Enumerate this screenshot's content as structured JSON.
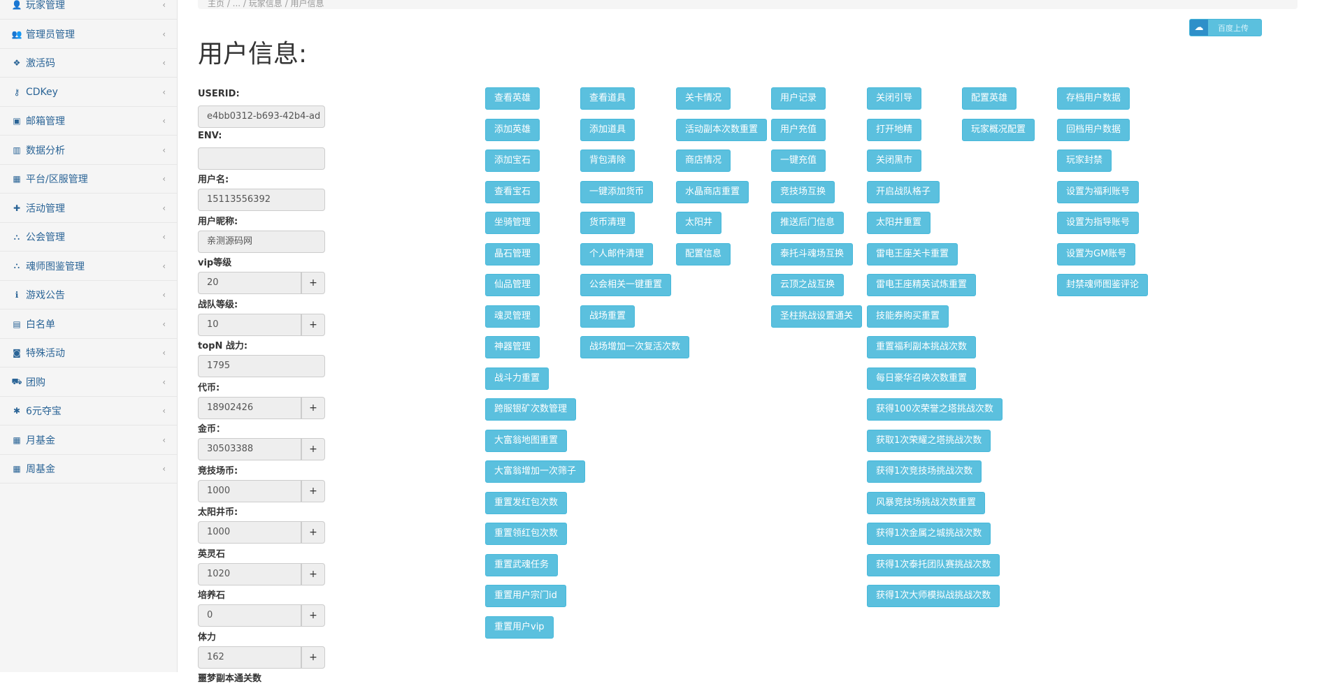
{
  "sidebar": {
    "items": [
      {
        "label": "玩家管理",
        "icon": "user-icon",
        "glyph": "👤"
      },
      {
        "label": "管理员管理",
        "icon": "users-icon",
        "glyph": "👥"
      },
      {
        "label": "激活码",
        "icon": "cube-icon",
        "glyph": "❖"
      },
      {
        "label": "CDKey",
        "icon": "key-icon",
        "glyph": "⚷"
      },
      {
        "label": "邮箱管理",
        "icon": "inbox-icon",
        "glyph": "▣"
      },
      {
        "label": "数据分析",
        "icon": "bar-chart-icon",
        "glyph": "▥"
      },
      {
        "label": "平台/区服管理",
        "icon": "bank-icon",
        "glyph": "▦"
      },
      {
        "label": "活动管理",
        "icon": "gift-icon",
        "glyph": "✚"
      },
      {
        "label": "公会管理",
        "icon": "sitemap-icon",
        "glyph": "⛬"
      },
      {
        "label": "魂师图鉴管理",
        "icon": "sitemap-icon",
        "glyph": "⛬"
      },
      {
        "label": "游戏公告",
        "icon": "info-icon",
        "glyph": "ℹ"
      },
      {
        "label": "白名单",
        "icon": "file-icon",
        "glyph": "▤"
      },
      {
        "label": "特殊活动",
        "icon": "money-icon",
        "glyph": "◙"
      },
      {
        "label": "团购",
        "icon": "cart-icon",
        "glyph": "⛟"
      },
      {
        "label": "6元夺宝",
        "icon": "asterisk-icon",
        "glyph": "✱"
      },
      {
        "label": "月基金",
        "icon": "calendar-icon",
        "glyph": "▦"
      },
      {
        "label": "周基金",
        "icon": "calendar-icon",
        "glyph": "▦"
      }
    ],
    "chevron": "‹"
  },
  "breadcrumb": "主页 / ... / 玩家信息 / 用户信息",
  "page_title": "用户信息:",
  "cloud_button": {
    "label": "百度上传",
    "glyph": "☁"
  },
  "form": {
    "fields": [
      {
        "label": "USERID:",
        "value": "e4bb0312-b693-42b4-ad",
        "plus": false
      },
      {
        "label": "ENV:",
        "value": "",
        "plus": false
      },
      {
        "label": "用户名:",
        "value": "15113556392",
        "plus": false
      },
      {
        "label": "用户昵称:",
        "value": "亲测源码网",
        "plus": false
      },
      {
        "label": "vip等级",
        "value": "20",
        "plus": true
      },
      {
        "label": "战队等级:",
        "value": "10",
        "plus": true
      },
      {
        "label": "topN 战力:",
        "value": "1795",
        "plus": false
      },
      {
        "label": "代币:",
        "value": "18902426",
        "plus": true
      },
      {
        "label": "金币：",
        "value": "30503388",
        "plus": true
      },
      {
        "label": "竞技场币:",
        "value": "1000",
        "plus": true
      },
      {
        "label": "太阳井币:",
        "value": "1000",
        "plus": true
      },
      {
        "label": "英灵石",
        "value": "1020",
        "plus": true
      },
      {
        "label": "培养石",
        "value": "0",
        "plus": true
      },
      {
        "label": "体力",
        "value": "162",
        "plus": true
      }
    ],
    "last_label": "噩梦副本通关数",
    "plus_label": "+"
  },
  "actions": {
    "col1": [
      "查看英雄",
      "添加英雄",
      "添加宝石",
      "查看宝石",
      "坐骑管理",
      "晶石管理",
      "仙品管理",
      "魂灵管理",
      "神器管理",
      "战斗力重置",
      "跨服银矿次数管理",
      "大富翁地图重置",
      "大富翁增加一次筛子",
      "重置发红包次数",
      "重置领红包次数",
      "重置武魂任务",
      "重置用户宗门id",
      "重置用户vip"
    ],
    "col2": [
      "查看道具",
      "添加道具",
      "背包清除",
      "一键添加货币",
      "货币清理",
      "个人邮件清理",
      "公会相关一键重置",
      "战场重置",
      "战场增加一次复活次数"
    ],
    "col3": [
      "关卡情况",
      "活动副本次数重置",
      "商店情况",
      "水晶商店重置",
      "太阳井",
      "配置信息"
    ],
    "col4": [
      "用户记录",
      "用户充值",
      "一键充值",
      "竞技场互换",
      "推送后门信息",
      "泰托斗魂场互换",
      "云顶之战互换",
      "圣柱挑战设置通关"
    ],
    "col5": [
      "关闭引导",
      "打开地精",
      "关闭黑市",
      "开启战队格子",
      "太阳井重置",
      "雷电王座关卡重置",
      "雷电王座精英试炼重置",
      "技能券购买重置",
      "重置福利副本挑战次数",
      "每日豪华召唤次数重置",
      "获得100次荣誉之塔挑战次数",
      "获取1次荣耀之塔挑战次数",
      "获得1次竞技场挑战次数",
      "风暴竞技场挑战次数重置",
      "获得1次金属之城挑战次数",
      "获得1次泰托团队赛挑战次数",
      "获得1次大师模拟战挑战次数"
    ],
    "col6": [
      "配置英雄",
      "玩家概况配置"
    ],
    "col7": [
      "存档用户数据",
      "回档用户数据",
      "玩家封禁",
      "设置为福利账号",
      "设置为指导账号",
      "设置为GM账号",
      "封禁魂师图鉴评论"
    ]
  }
}
